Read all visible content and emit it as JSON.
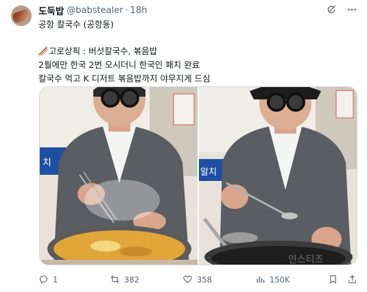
{
  "author": {
    "display_name": "도둑밥",
    "handle": "@babstealer",
    "separator": "·",
    "time": "18h"
  },
  "tweet": {
    "lines": [
      "공항 칼국수 (공항동)",
      "",
      "고로상픽 : 버섯칼국수, 볶음밥",
      "2월에만 한국 2번 오시더니 한국인 패치 완료",
      "칼국수 먹고 K 디저트 볶음밥까지 야무지게 드심"
    ],
    "emoji_icon": "chopsticks-icon"
  },
  "media": {
    "photo_count": 2,
    "photo_1_sign_text": "치",
    "photo_2_sign_text": "알치",
    "watermark": "인스티즈"
  },
  "actions": {
    "replies": "1",
    "retweets": "382",
    "likes": "358",
    "views": "150K"
  },
  "icons": {
    "top": [
      "grok-icon",
      "more-icon"
    ],
    "bar": [
      "reply-icon",
      "retweet-icon",
      "like-icon",
      "views-icon",
      "bookmark-icon",
      "share-icon"
    ]
  },
  "colors": {
    "text": "#0f1419",
    "secondary": "#536471",
    "border": "#cfd9de",
    "sign_blue": "#1f4fa3"
  }
}
